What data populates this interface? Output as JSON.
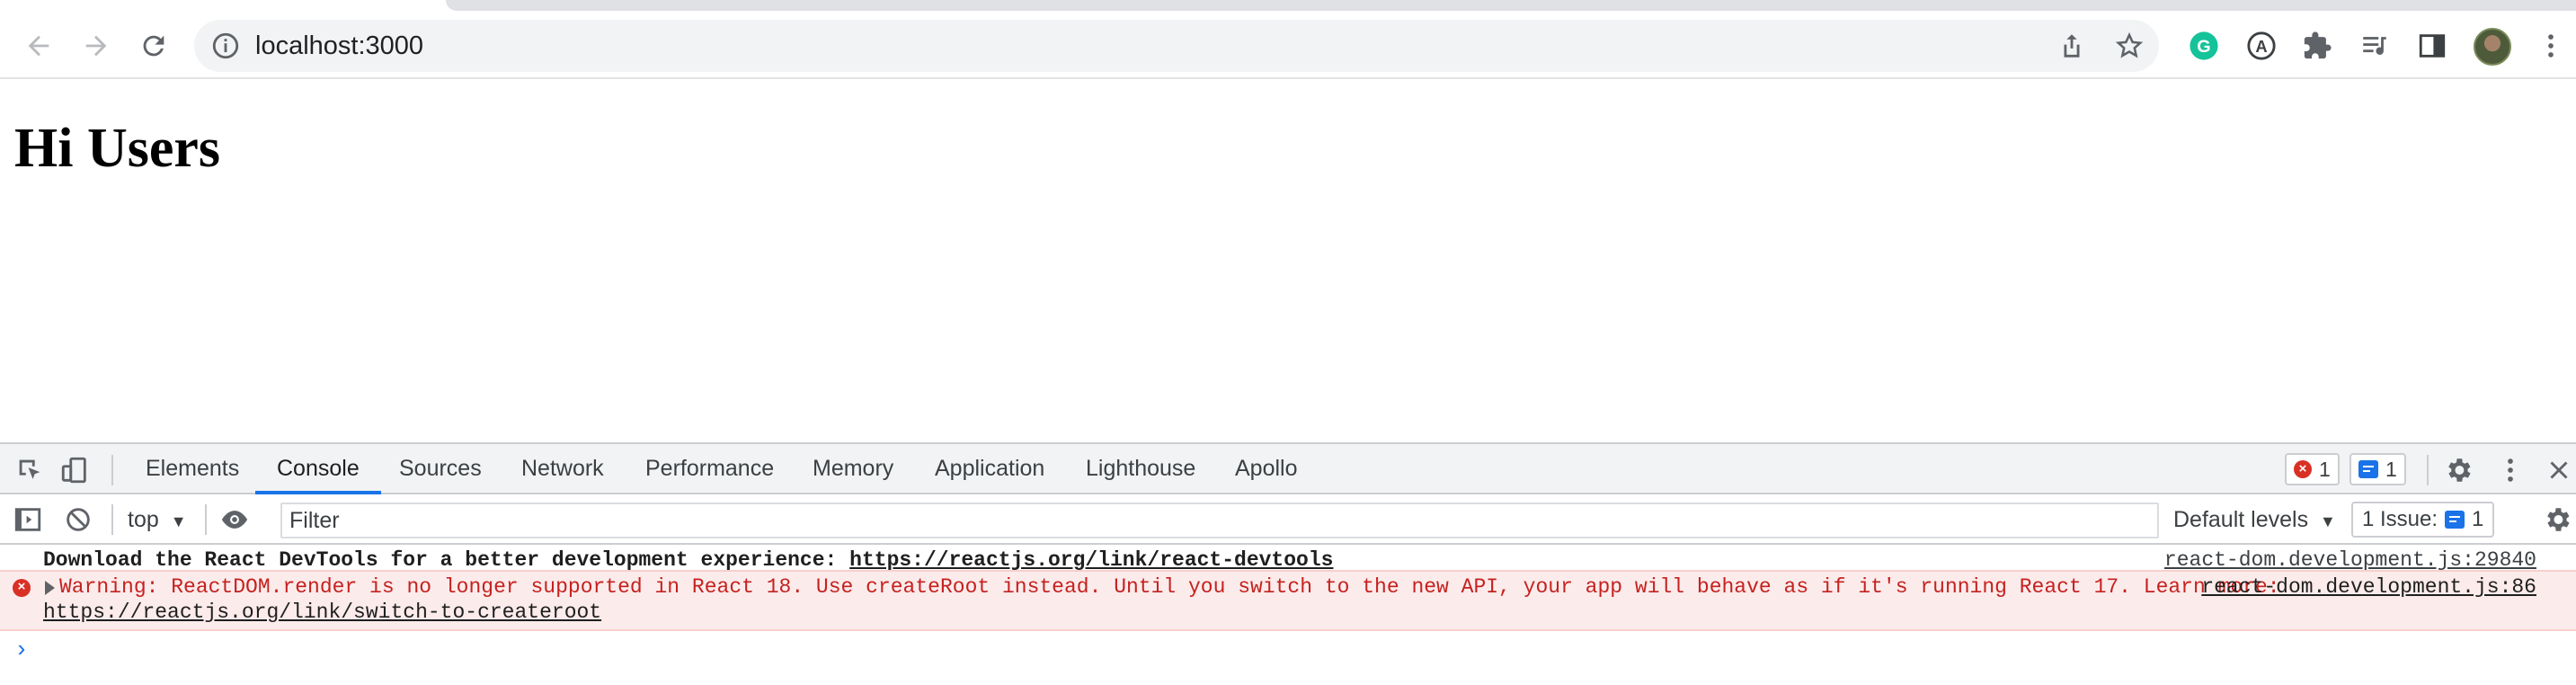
{
  "browser": {
    "address": "localhost:3000",
    "icons": {
      "back": "back-arrow-icon",
      "forward": "forward-arrow-icon",
      "reload": "reload-icon",
      "site_info": "info-icon",
      "share": "share-icon",
      "bookmark": "star-icon",
      "grammarly": "grammarly-icon",
      "extension_a": "a-extension-icon",
      "extensions": "puzzle-icon",
      "reading_list": "reading-list-icon",
      "side_panel": "side-panel-icon",
      "profile": "avatar",
      "menu": "kebab-menu-icon"
    }
  },
  "page": {
    "heading": "Hi Users"
  },
  "devtools": {
    "tabs": [
      "Elements",
      "Console",
      "Sources",
      "Network",
      "Performance",
      "Memory",
      "Application",
      "Lighthouse",
      "Apollo"
    ],
    "active_tab": "Console",
    "error_count": "1",
    "message_count": "1",
    "console": {
      "context": "top",
      "filter_placeholder": "Filter",
      "levels": "Default levels",
      "issues_label": "1 Issue:",
      "issues_count": "1",
      "messages": {
        "devtools_text": "Download the React DevTools for a better development experience: ",
        "devtools_link": "https://reactjs.org/link/react-devtools",
        "devtools_source": "react-dom.development.js:29840",
        "warning_text": "Warning: ReactDOM.render is no longer supported in React 18. Use createRoot instead. Until you switch to the new API, your app will behave as if it's running React 17. Learn more:",
        "warning_link": "https://reactjs.org/link/switch-to-createroot",
        "warning_source": "react-dom.development.js:86"
      }
    }
  },
  "colors": {
    "accent": "#1a73e8",
    "error": "#d93025",
    "error_bg": "#fcebeb"
  }
}
